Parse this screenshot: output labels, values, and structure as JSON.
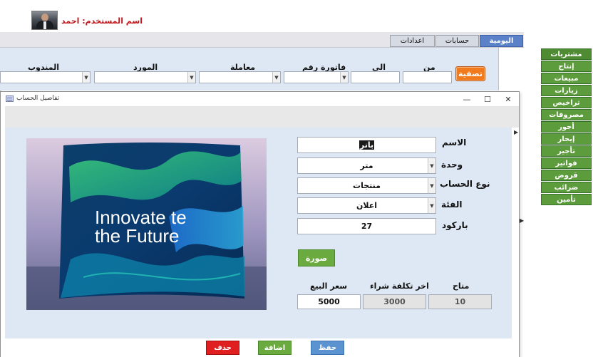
{
  "user": {
    "label": "اسم المستخدم: احمد"
  },
  "tabs": [
    {
      "label": "اليومية",
      "active": true
    },
    {
      "label": "حسابات"
    },
    {
      "label": "اعدادات"
    }
  ],
  "filters": {
    "clean_button": "تصفية",
    "labels": {
      "from": "من",
      "to": "الى",
      "invoice": "فاتورة رقم",
      "transaction": "معاملة",
      "supplier": "المورد",
      "delegate": "المندوب"
    }
  },
  "side_menu": [
    "مشتريات",
    "إنتاج",
    "مبيعات",
    "زيارات",
    "تراخيص",
    "مصروفات",
    "أجور",
    "إيجار",
    "تأجير",
    "فواتير",
    "قروض",
    "ضرائب",
    "تأمين"
  ],
  "dialog": {
    "title": "تفاصيل الحساب",
    "image_text": [
      "Innovate te",
      "the Future"
    ],
    "fields": {
      "name_label": "الاسم",
      "name_value": "بانر",
      "unit_label": "وحدة",
      "unit_value": "متر",
      "type_label": "نوع الحساب",
      "type_value": "منتجات",
      "category_label": "الفئة",
      "category_value": "اعلان",
      "barcode_label": "باركود",
      "barcode_value": "27"
    },
    "photo_button": "صورة",
    "totals": {
      "available_label": "متاح",
      "available_value": "10",
      "last_cost_label": "اخر تكلفة شراء",
      "last_cost_value": "3000",
      "price_label": "سعر البيع",
      "price_value": "5000"
    },
    "buttons": {
      "save": "حفظ",
      "add": "اضافة",
      "delete": "حذف"
    }
  },
  "colors": {
    "accent_tab": "#5b82c9",
    "menu_green": "#5d9c3c",
    "filter_orange": "#f07a1c",
    "delete_red": "#e02020",
    "username_red": "#c0161b"
  }
}
